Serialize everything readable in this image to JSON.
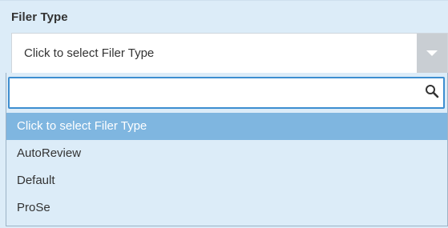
{
  "field": {
    "label": "Filer Type",
    "selected_value": "Click to select Filer Type"
  },
  "dropdown": {
    "search": {
      "value": "",
      "placeholder": "",
      "icon": "search-icon"
    },
    "options": [
      {
        "label": "Click to select Filer Type",
        "highlighted": true
      },
      {
        "label": "AutoReview",
        "highlighted": false
      },
      {
        "label": "Default",
        "highlighted": false
      },
      {
        "label": "ProSe",
        "highlighted": false
      }
    ]
  },
  "colors": {
    "panel_bg": "#dcecf8",
    "highlight_bg": "#7fb6e0",
    "focus_border": "#3d8ed0",
    "arrow_bg": "#c9ced3"
  }
}
